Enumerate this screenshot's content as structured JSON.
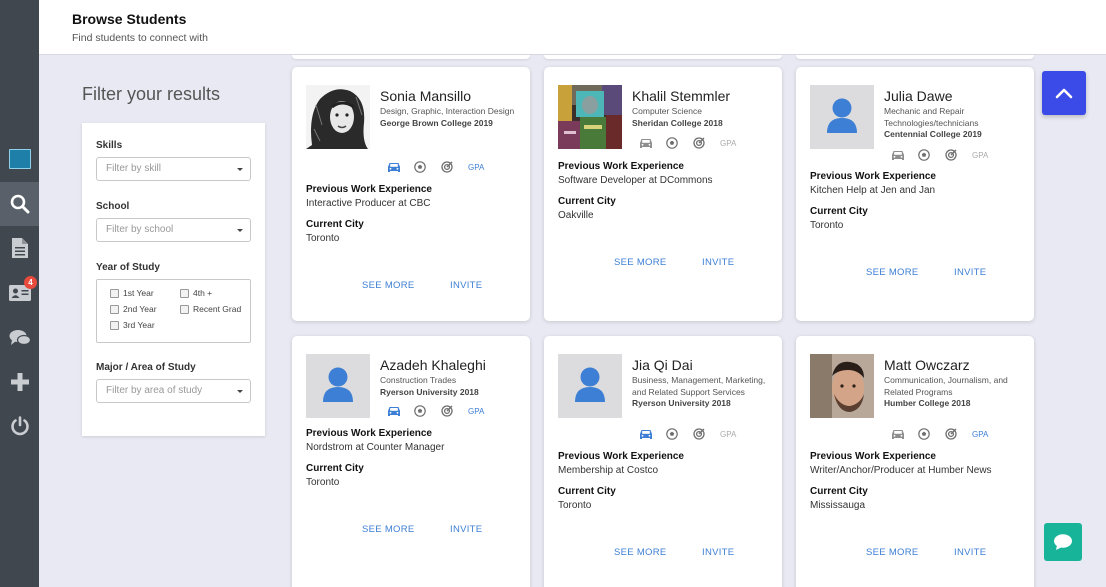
{
  "header": {
    "title": "Browse Students",
    "subtitle": "Find students to connect with"
  },
  "rail": {
    "items": [
      "logo",
      "search-icon",
      "document-icon",
      "contact-card-icon",
      "chat-icon",
      "plus-icon",
      "power-icon"
    ],
    "badge": "4"
  },
  "filter": {
    "title": "Filter your results",
    "skills_label": "Skills",
    "skills_placeholder": "Filter by skill",
    "school_label": "School",
    "school_placeholder": "Filter by school",
    "year_label": "Year of Study",
    "years": [
      "1st Year",
      "4th +",
      "2nd Year",
      "Recent Grad",
      "3rd Year"
    ],
    "major_label": "Major / Area of Study",
    "major_placeholder": "Filter by area of study"
  },
  "card_labels": {
    "work": "Previous Work Experience",
    "city": "Current City",
    "see_more": "SEE MORE",
    "invite": "INVITE",
    "gpa": "GPA"
  },
  "students": [
    {
      "name": "Sonia Mansillo",
      "major": "Design, Graphic, Interaction Design",
      "school": "George Brown College 2019",
      "work": "Interactive Producer at CBC",
      "city": "Toronto",
      "photo": "sketch-portrait",
      "icons_active": [
        true,
        false,
        false,
        true
      ]
    },
    {
      "name": "Khalil Stemmler",
      "major": "Computer Science",
      "school": "Sheridan College 2018",
      "work": "Software Developer at DCommons",
      "city": "Oakville",
      "photo": "collage-portrait",
      "icons_active": [
        false,
        false,
        false,
        false
      ]
    },
    {
      "name": "Julia Dawe",
      "major": "Mechanic and Repair Technologies/technicians",
      "school": "Centennial College 2019",
      "work": "Kitchen Help at Jen and Jan",
      "city": "Toronto",
      "photo": "placeholder",
      "icons_active": [
        false,
        false,
        false,
        false
      ]
    },
    {
      "name": "Azadeh Khaleghi",
      "major": "Construction Trades",
      "school": "Ryerson University 2018",
      "work": "Nordstrom at Counter Manager",
      "city": "Toronto",
      "photo": "placeholder",
      "icons_active": [
        true,
        false,
        false,
        true
      ]
    },
    {
      "name": "Jia Qi Dai",
      "major": "Business, Management, Marketing, and Related Support Services",
      "school": "Ryerson University 2018",
      "work": "Membership at Costco",
      "city": "Toronto",
      "photo": "placeholder",
      "icons_active": [
        true,
        false,
        false,
        false
      ]
    },
    {
      "name": "Matt Owczarz",
      "major": "Communication, Journalism, and Related Programs",
      "school": "Humber College 2018",
      "work": "Writer/Anchor/Producer at Humber News",
      "city": "Mississauga",
      "photo": "man-portrait",
      "icons_active": [
        false,
        false,
        false,
        true
      ]
    }
  ],
  "colors": {
    "accent": "#3d7fd4",
    "rail": "#40474f",
    "scroll_top": "#3b4be8",
    "chat": "#18b49a",
    "badge": "#e84a3c"
  }
}
